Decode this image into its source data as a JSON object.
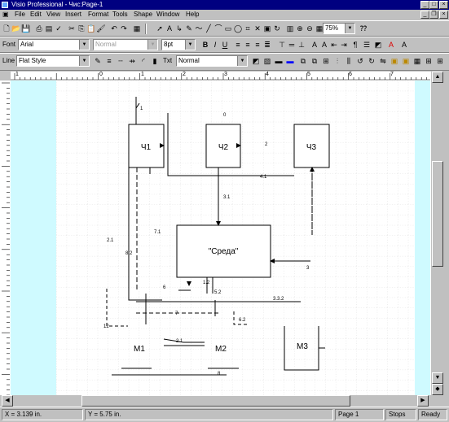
{
  "window": {
    "title": "Visio Professional - Чис:Page-1",
    "controls": [
      "_",
      "□",
      "×"
    ]
  },
  "menu": [
    "File",
    "Edit",
    "View",
    "Insert",
    "Format",
    "Tools",
    "Shape",
    "Window",
    "Help"
  ],
  "toolbar1": {
    "zoom": "75%"
  },
  "toolbar2": {
    "font_label": "Font",
    "font": "Arial",
    "style_placeholder": "Normal",
    "size": "8pt",
    "bold": "B",
    "italic": "I",
    "underline": "U"
  },
  "toolbar3": {
    "line_label": "Line",
    "line_style": "Flat Style",
    "text_label": "Txt",
    "text_style": "Normal"
  },
  "ruler": {
    "h_ticks": [
      "1",
      "0",
      "1",
      "2",
      "3",
      "4",
      "5",
      "6",
      "7",
      "8",
      "9"
    ]
  },
  "diagram": {
    "blocks": [
      "Ч1",
      "Ч2",
      "Ч3",
      "\"Среда\"",
      "М1",
      "М2",
      "М3"
    ],
    "labels": {
      "l1": "1",
      "l2": "0",
      "l3": "2",
      "l4": "4.1",
      "l5": "3.1",
      "l6": "7.1",
      "l7": "8.2",
      "l8": "2.1",
      "l9": "3",
      "l10": "6",
      "l11": "1.2",
      "l12": "5.2",
      "l13": "3.3.2",
      "l14": "7",
      "l15": "6.2",
      "l16": "12",
      "l17": "2.1",
      "l18": "8"
    }
  },
  "status": {
    "x": "X = 3.139 in.",
    "y": "Y = 5.75 in.",
    "page": "Page 1",
    "stops": "Stops",
    "ready": "Ready"
  },
  "colors": {
    "title_bar": "#000080",
    "canvas": "#cffaff",
    "chrome": "#c0c0c0"
  }
}
